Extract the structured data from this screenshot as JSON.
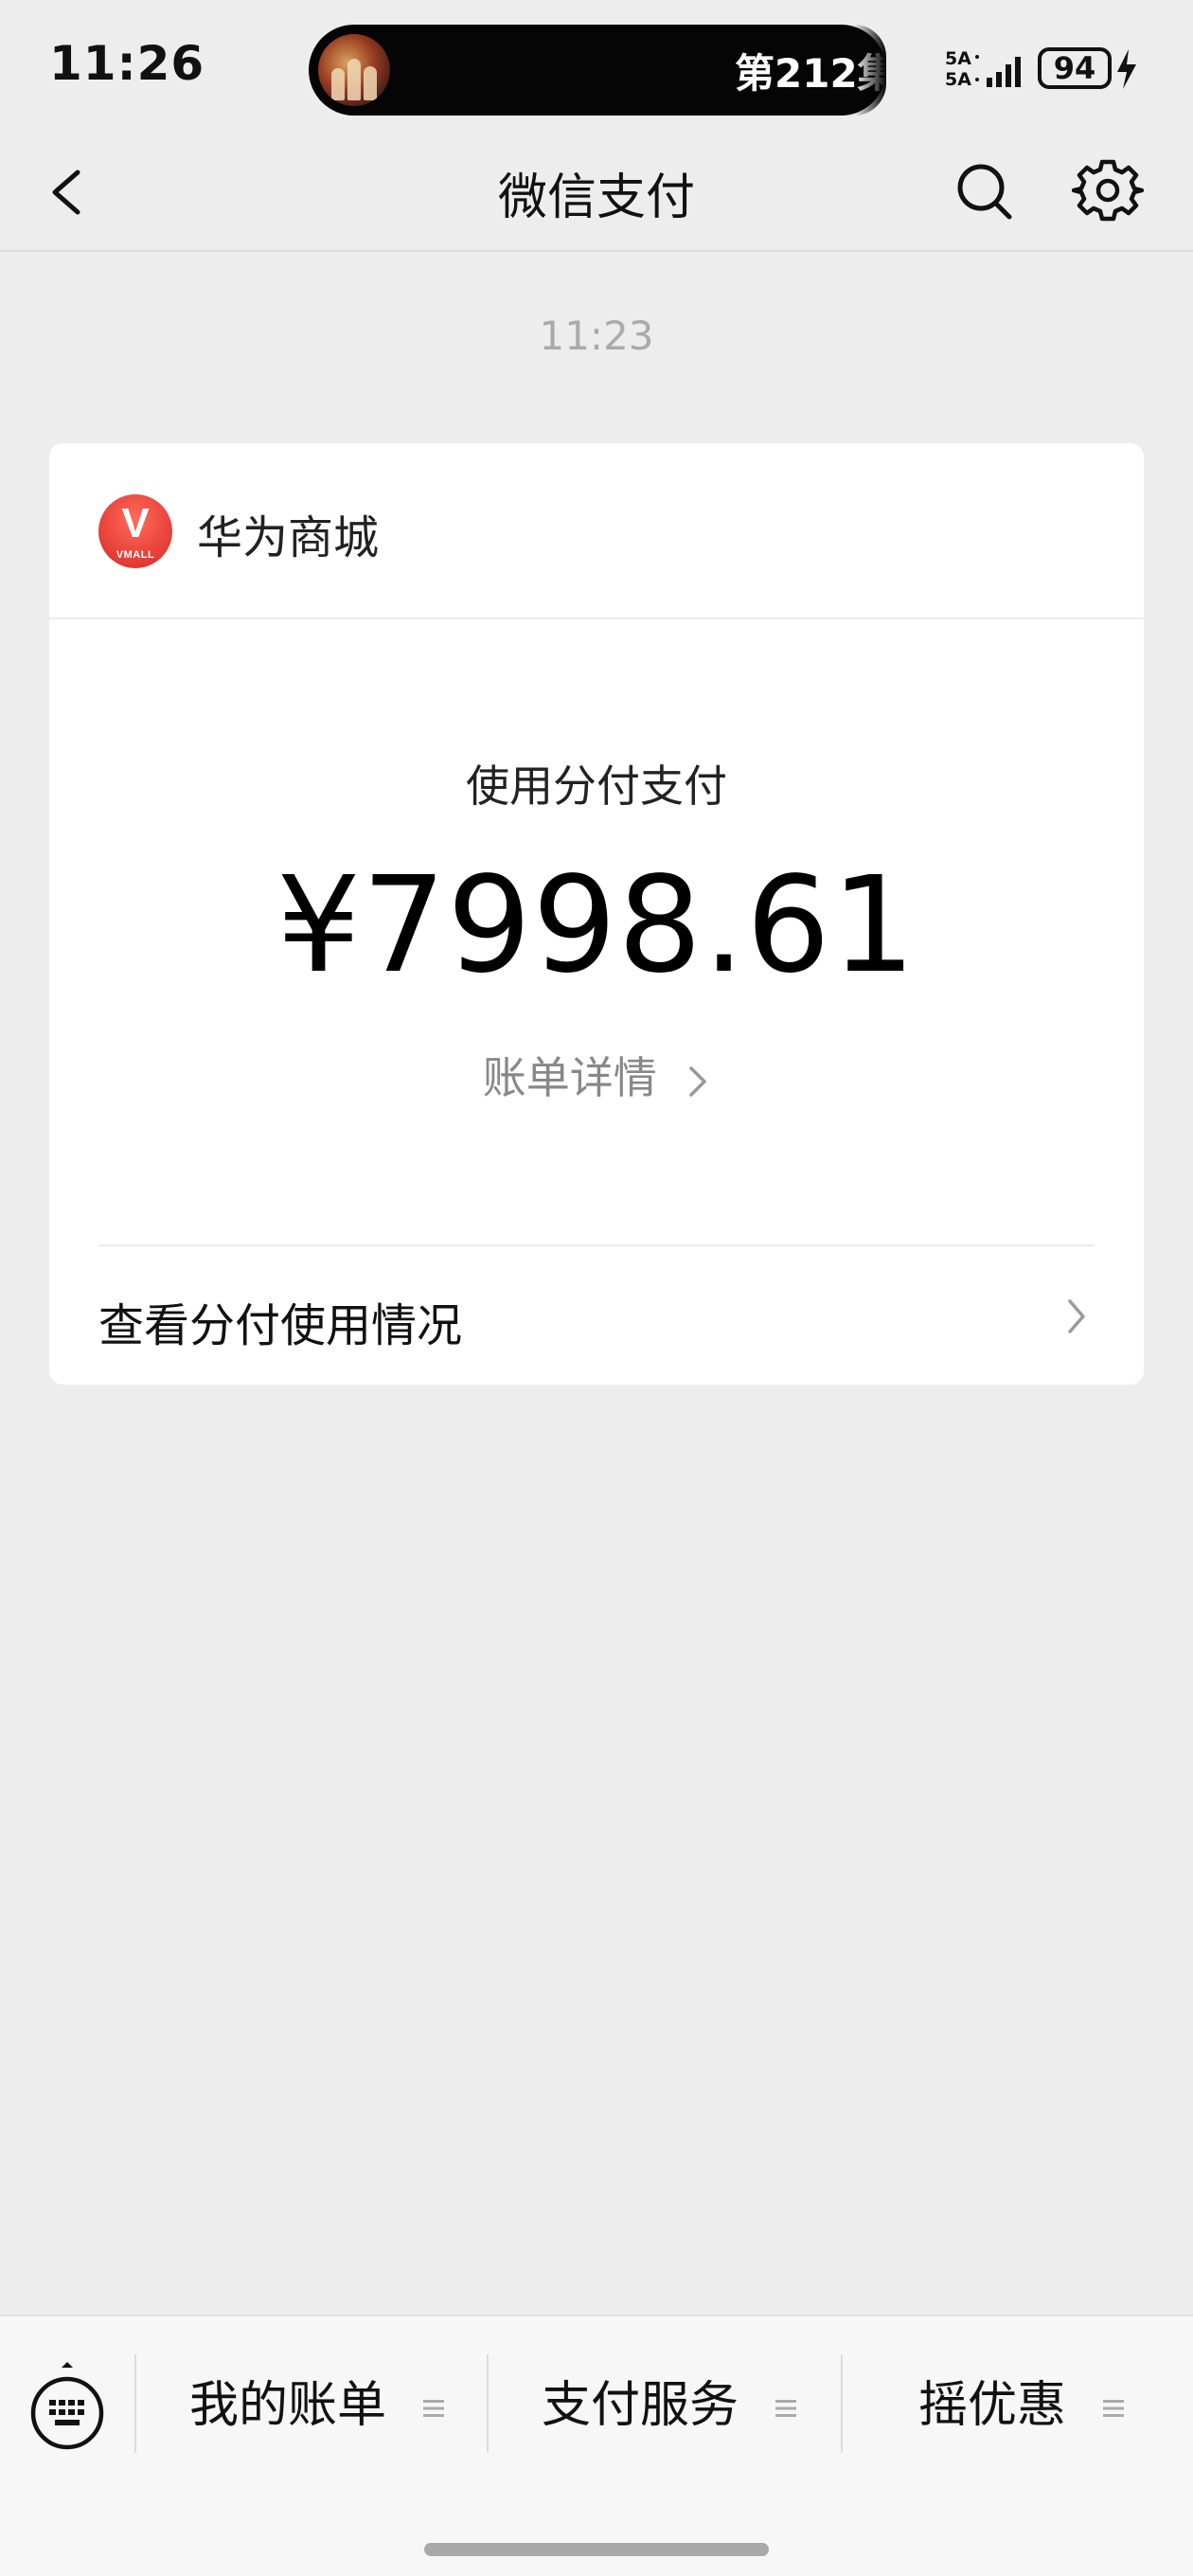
{
  "status_bar": {
    "time": "11:26",
    "island_text": "第212集",
    "network_top": "5A",
    "network_bottom": "5A",
    "battery": "94"
  },
  "nav": {
    "title": "微信支付",
    "back_icon": "chevron-left-icon",
    "search_icon": "search-icon",
    "settings_icon": "gear-icon"
  },
  "message": {
    "time": "11:23",
    "merchant_name": "华为商城",
    "merchant_logo_letter": "V",
    "merchant_logo_text": "VMALL",
    "pay_label": "使用分付支付",
    "amount": "¥7998.61",
    "bill_link": "账单详情",
    "usage_label": "查看分付使用情况"
  },
  "bottom_menu": {
    "items": [
      {
        "label": "我的账单"
      },
      {
        "label": "支付服务"
      },
      {
        "label": "摇优惠"
      }
    ]
  },
  "colors": {
    "background": "#ededed",
    "card": "#ffffff",
    "logo_red": "#e8423a",
    "secondary_text": "#888888"
  }
}
